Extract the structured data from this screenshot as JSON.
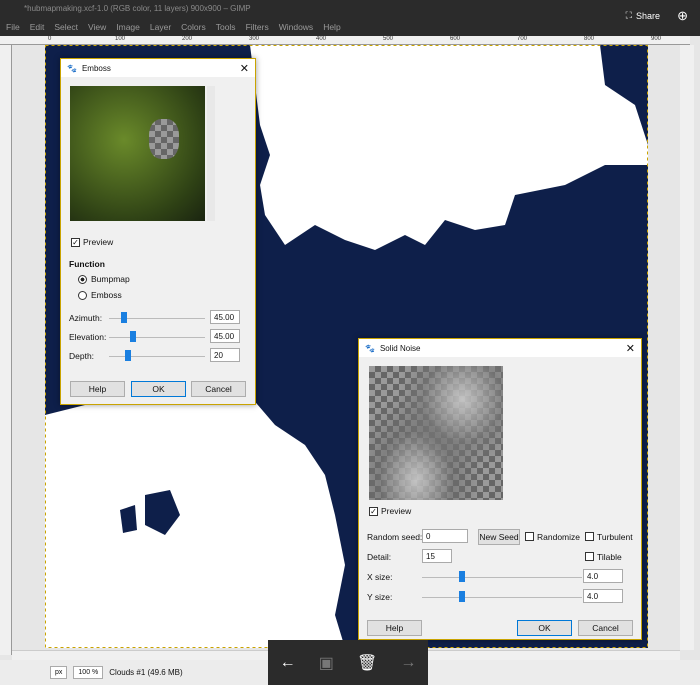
{
  "window": {
    "title": "*hubmapmaking.xcf-1.0 (RGB color, 11 layers) 900x900 – GIMP",
    "share": "Share",
    "zoom_icon": "zoom-in-icon"
  },
  "menu": [
    "File",
    "Edit",
    "Select",
    "View",
    "Image",
    "Layer",
    "Colors",
    "Tools",
    "Filters",
    "Windows",
    "Help"
  ],
  "ruler": [
    "0",
    "100",
    "200",
    "300",
    "400",
    "500",
    "600",
    "700",
    "800",
    "900"
  ],
  "status": {
    "unit": "px",
    "zoom": "100 %",
    "info": "Clouds #1 (49.6 MB)"
  },
  "emboss": {
    "title": "Emboss",
    "preview": "Preview",
    "function_label": "Function",
    "options": [
      "Bumpmap",
      "Emboss"
    ],
    "selected": "Bumpmap",
    "azimuth_label": "Azimuth:",
    "azimuth": "45.00",
    "elevation_label": "Elevation:",
    "elevation": "45.00",
    "depth_label": "Depth:",
    "depth": "20",
    "azimuth_pct": 0.16,
    "elevation_pct": 0.25,
    "depth_pct": 0.2,
    "help": "Help",
    "ok": "OK",
    "cancel": "Cancel"
  },
  "noise": {
    "title": "Solid Noise",
    "preview": "Preview",
    "seed_label": "Random seed:",
    "seed": "0",
    "new_seed": "New Seed",
    "randomize": "Randomize",
    "turbulent": "Turbulent",
    "tilable": "Tilable",
    "detail_label": "Detail:",
    "detail": "15",
    "xsize_label": "X size:",
    "xsize": "4.0",
    "ysize_label": "Y size:",
    "ysize": "4.0",
    "xsize_pct": 0.25,
    "ysize_pct": 0.25,
    "help": "Help",
    "ok": "OK",
    "cancel": "Cancel"
  },
  "colors": {
    "navy": "#0e1f4a",
    "accent": "#1a7fe0",
    "dialog_border": "#c9a300"
  }
}
